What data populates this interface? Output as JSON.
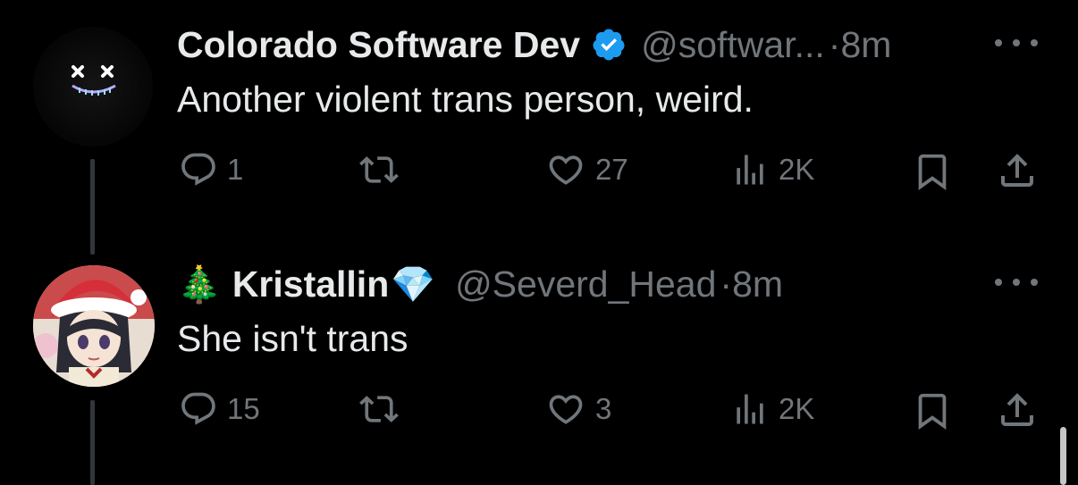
{
  "tweets": [
    {
      "name": "Colorado Software Dev",
      "handle": "@softwar...",
      "separator": "·",
      "time": "8m",
      "text": "Another violent trans person, weird.",
      "verified": true,
      "replies": "1",
      "retweets": "",
      "likes": "27",
      "views": "2K"
    },
    {
      "name_prefix_emoji": "🎄",
      "name": "Kristallin",
      "name_suffix_emoji": "💎",
      "handle": "@Severd_Head",
      "separator": "·",
      "time": "8m",
      "text": "She isn't trans",
      "verified": false,
      "replies": "15",
      "retweets": "",
      "likes": "3",
      "views": "2K"
    }
  ],
  "colors": {
    "background": "#000000",
    "primary_text": "#e7e9ea",
    "secondary_text": "#71767b",
    "verified_badge": "#1d9bf0",
    "thread_line": "#333639"
  },
  "icons": [
    "verified-badge-icon",
    "more-icon",
    "reply-icon",
    "retweet-icon",
    "like-icon",
    "views-icon",
    "bookmark-icon",
    "share-icon"
  ]
}
